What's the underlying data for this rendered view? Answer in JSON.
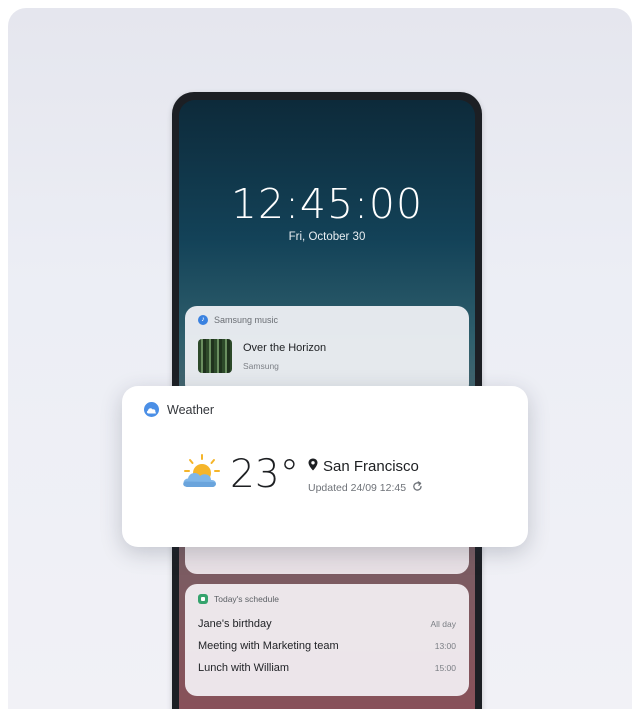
{
  "lockscreen": {
    "time": "12:45:00",
    "date": "Fri, October 30"
  },
  "music_notification": {
    "app_name": "Samsung music",
    "song_title": "Over the Horizon",
    "artist": "Samsung"
  },
  "weather_widget": {
    "app_name": "Weather",
    "icon": "partly-cloudy-icon",
    "temperature": "23°",
    "location": "San Francisco",
    "updated": "Updated 24/09 12:45"
  },
  "schedule": {
    "header": "Today's schedule",
    "events": [
      {
        "title": "Jane's birthday",
        "time": "All day"
      },
      {
        "title": "Meeting with Marketing team",
        "time": "13:00"
      },
      {
        "title": "Lunch with William",
        "time": "15:00"
      }
    ]
  },
  "colors": {
    "accent_blue": "#3a82e0",
    "calendar_green": "#35a36d",
    "sun_yellow": "#f5b52a",
    "cloud_blue": "#7fb6e8"
  }
}
